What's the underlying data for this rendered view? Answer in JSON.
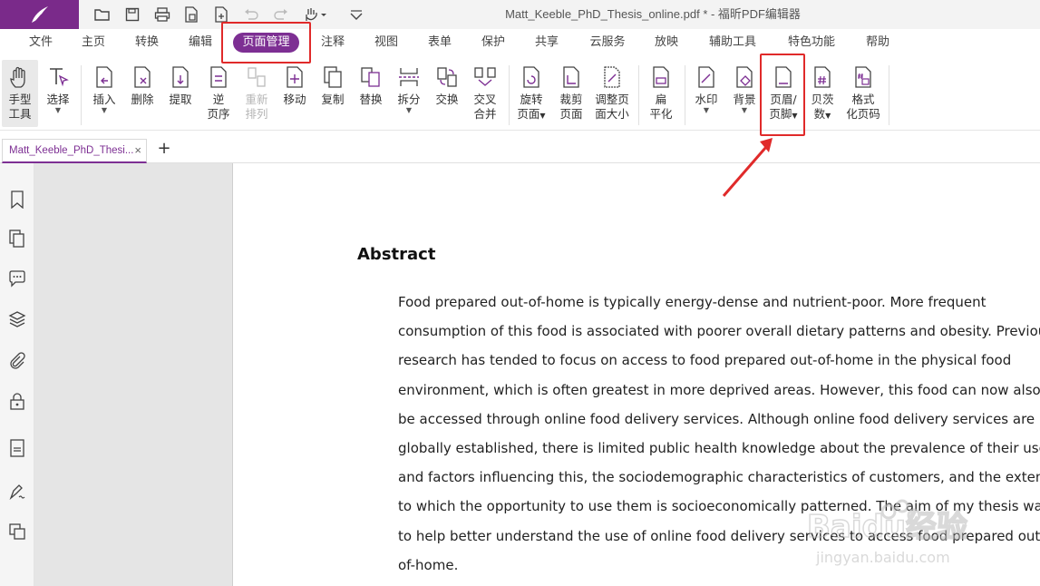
{
  "titlebar": {
    "title": "Matt_Keeble_PhD_Thesis_online.pdf * - 福昕PDF编辑器"
  },
  "quick_access": [
    "open-icon",
    "save-icon",
    "print-icon",
    "new-doc-icon",
    "create-icon",
    "undo-icon",
    "redo-icon",
    "hand-icon",
    "customize-icon"
  ],
  "menu": {
    "items": [
      "文件",
      "主页",
      "转换",
      "编辑",
      "页面管理",
      "注释",
      "视图",
      "表单",
      "保护",
      "共享",
      "云服务",
      "放映",
      "辅助工具",
      "特色功能",
      "帮助"
    ],
    "active_index": 4
  },
  "ribbon": {
    "buttons": [
      {
        "l1": "手型",
        "l2": "工具",
        "icon": "hand-tool-icon"
      },
      {
        "l1": "选择",
        "l2": "",
        "icon": "select-icon"
      },
      {
        "l1": "插入",
        "l2": "",
        "icon": "insert-page-icon"
      },
      {
        "l1": "删除",
        "l2": "",
        "icon": "delete-page-icon"
      },
      {
        "l1": "提取",
        "l2": "",
        "icon": "extract-page-icon"
      },
      {
        "l1": "逆",
        "l2": "页序",
        "icon": "reverse-order-icon"
      },
      {
        "l1": "重新",
        "l2": "排列",
        "icon": "rearrange-icon"
      },
      {
        "l1": "移动",
        "l2": "",
        "icon": "move-page-icon"
      },
      {
        "l1": "复制",
        "l2": "",
        "icon": "copy-page-icon"
      },
      {
        "l1": "替换",
        "l2": "",
        "icon": "replace-page-icon"
      },
      {
        "l1": "拆分",
        "l2": "",
        "icon": "split-icon"
      },
      {
        "l1": "交换",
        "l2": "",
        "icon": "swap-icon"
      },
      {
        "l1": "交叉",
        "l2": "合并",
        "icon": "cross-merge-icon"
      },
      {
        "l1": "旋转",
        "l2": "页面",
        "icon": "rotate-page-icon"
      },
      {
        "l1": "裁剪",
        "l2": "页面",
        "icon": "crop-page-icon"
      },
      {
        "l1": "调整页",
        "l2": "面大小",
        "icon": "resize-page-icon"
      },
      {
        "l1": "扁",
        "l2": "平化",
        "icon": "flatten-icon"
      },
      {
        "l1": "水印",
        "l2": "",
        "icon": "watermark-icon"
      },
      {
        "l1": "背景",
        "l2": "",
        "icon": "background-icon"
      },
      {
        "l1": "页眉/",
        "l2": "页脚",
        "icon": "header-footer-icon"
      },
      {
        "l1": "贝茨",
        "l2": "数",
        "icon": "bates-number-icon"
      },
      {
        "l1": "格式",
        "l2": "化页码",
        "icon": "format-page-number-icon"
      }
    ]
  },
  "tabs": {
    "document_tab": "Matt_Keeble_PhD_Thesi...",
    "close": "×",
    "add": "+"
  },
  "left_panel": [
    "bookmark-icon",
    "pages-icon",
    "comments-icon",
    "layers-icon",
    "attachments-icon",
    "security-icon",
    "form-icon",
    "signature-icon",
    "compare-icon"
  ],
  "document": {
    "heading": "Abstract",
    "lines": [
      "Food prepared out-of-home is typically energy-dense and nutrient-poor. More frequent",
      "consumption of this food is associated with poorer overall dietary patterns and obesity. Previous",
      "research has tended to focus on access to food prepared out-of-home in the physical food",
      "environment, which is often greatest in more deprived areas. However, this food can now also",
      "be accessed through online food delivery services. Although online food delivery services are",
      "globally established, there is limited public health knowledge about the prevalence of their use",
      "and factors influencing this, the sociodemographic characteristics of customers, and the extent",
      "to which the opportunity to use them is socioeconomically patterned. The aim of my thesis was",
      "to help better understand the use of online food delivery services to access food prepared out-",
      "of-home."
    ]
  },
  "watermark": {
    "brand": "Baidu经验",
    "url": "jingyan.baidu.com"
  },
  "colors": {
    "brand": "#7a2a8a",
    "active_menu": "#7d2f93",
    "highlight": "#e02a2a"
  }
}
